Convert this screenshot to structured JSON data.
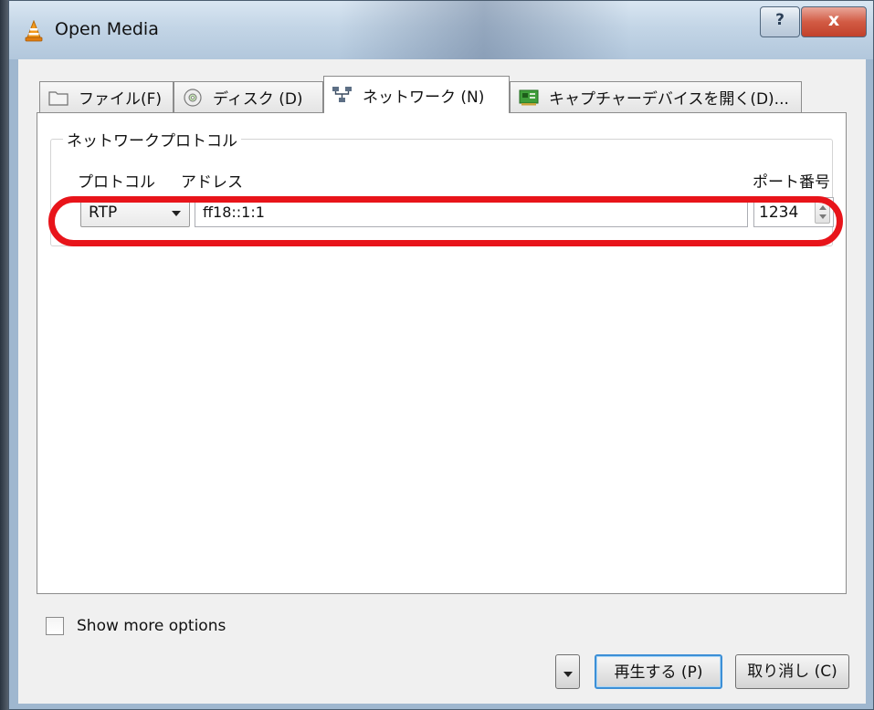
{
  "window": {
    "title": "Open Media",
    "help_label": "?",
    "close_label": "x"
  },
  "tabs": [
    {
      "label": "ファイル(F)",
      "icon": "folder-icon"
    },
    {
      "label": "ディスク (D)",
      "icon": "disc-icon"
    },
    {
      "label": "ネットワーク (N)",
      "icon": "network-icon",
      "active": true
    },
    {
      "label": "キャプチャーデバイスを開く(D)...",
      "icon": "capture-card-icon"
    }
  ],
  "network": {
    "group_title": "ネットワークプロトコル",
    "protocol_label": "プロトコル",
    "address_label": "アドレス",
    "port_label": "ポート番号",
    "protocol_value": "RTP",
    "address_value": "ff18::1:1",
    "port_value": "1234"
  },
  "options": {
    "show_more_label": "Show more options",
    "show_more_checked": false
  },
  "buttons": {
    "play_label": "再生する (P)",
    "cancel_label": "取り消し (C)"
  },
  "colors": {
    "highlight": "#e8141a",
    "default_button_border": "#3c8fd6"
  }
}
